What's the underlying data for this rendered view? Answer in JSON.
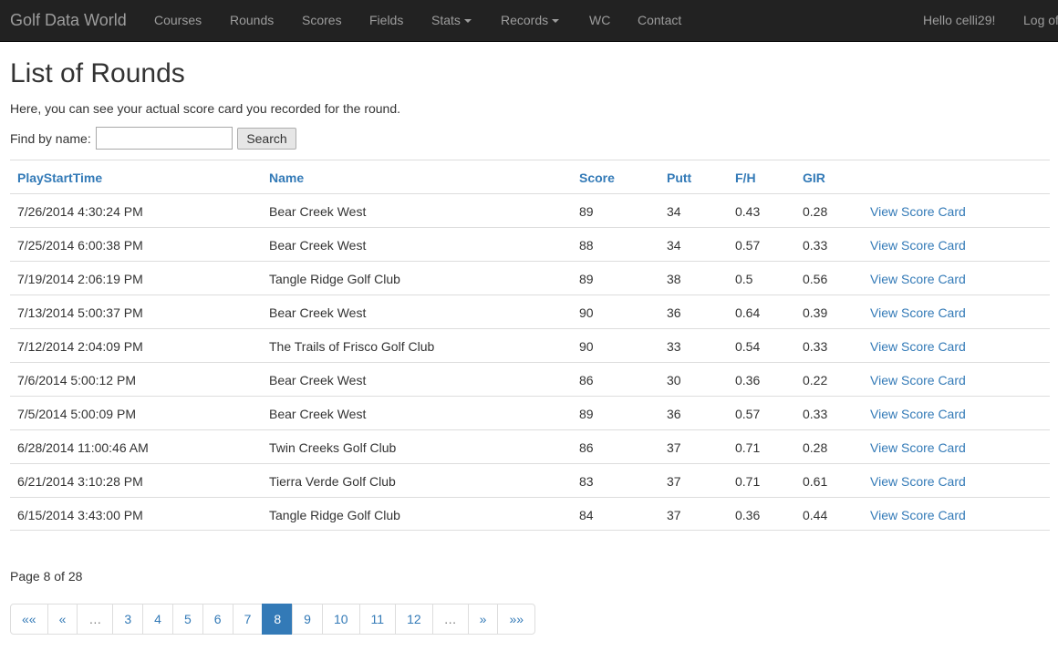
{
  "navbar": {
    "brand": "Golf Data World",
    "items": [
      "Courses",
      "Rounds",
      "Scores",
      "Fields",
      "Stats",
      "Records",
      "WC",
      "Contact"
    ],
    "greeting": "Hello celli29!",
    "logoff": "Log off"
  },
  "page": {
    "title": "List of Rounds",
    "intro": "Here, you can see your actual score card you recorded for the round.",
    "find_label": "Find by name:",
    "search_value": "",
    "search_button": "Search"
  },
  "table": {
    "headers": [
      "PlayStartTime",
      "Name",
      "Score",
      "Putt",
      "F/H",
      "GIR"
    ],
    "link_label": "View Score Card",
    "rows": [
      [
        "7/26/2014 4:30:24 PM",
        "Bear Creek West",
        "89",
        "34",
        "0.43",
        "0.28"
      ],
      [
        "7/25/2014 6:00:38 PM",
        "Bear Creek West",
        "88",
        "34",
        "0.57",
        "0.33"
      ],
      [
        "7/19/2014 2:06:19 PM",
        "Tangle Ridge Golf Club",
        "89",
        "38",
        "0.5",
        "0.56"
      ],
      [
        "7/13/2014 5:00:37 PM",
        "Bear Creek West",
        "90",
        "36",
        "0.64",
        "0.39"
      ],
      [
        "7/12/2014 2:04:09 PM",
        "The Trails of Frisco Golf Club",
        "90",
        "33",
        "0.54",
        "0.33"
      ],
      [
        "7/6/2014 5:00:12 PM",
        "Bear Creek West",
        "86",
        "30",
        "0.36",
        "0.22"
      ],
      [
        "7/5/2014 5:00:09 PM",
        "Bear Creek West",
        "89",
        "36",
        "0.57",
        "0.33"
      ],
      [
        "6/28/2014 11:00:46 AM",
        "Twin Creeks Golf Club",
        "86",
        "37",
        "0.71",
        "0.28"
      ],
      [
        "6/21/2014 3:10:28 PM",
        "Tierra Verde Golf Club",
        "83",
        "37",
        "0.71",
        "0.61"
      ],
      [
        "6/15/2014 3:43:00 PM",
        "Tangle Ridge Golf Club",
        "84",
        "37",
        "0.36",
        "0.44"
      ]
    ]
  },
  "pagination": {
    "info": "Page 8 of 28",
    "items": [
      "««",
      "«",
      "…",
      "3",
      "4",
      "5",
      "6",
      "7",
      "8",
      "9",
      "10",
      "11",
      "12",
      "…",
      "»",
      "»»"
    ],
    "current": "8"
  },
  "colors": {
    "navbar_bg": "#222222",
    "nav_text": "#9d9d9d",
    "link": "#337ab7",
    "border": "#dddddd"
  }
}
